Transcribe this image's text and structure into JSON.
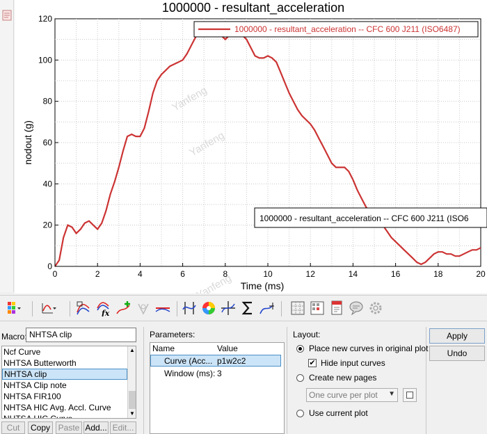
{
  "plot": {
    "title": "1000000 - resultant_acceleration",
    "legend_text": "1000000 - resultant_acceleration -- CFC 600  J211 (ISO6487)",
    "tooltip_text": "1000000 - resultant_acceleration -- CFC 600  J211 (ISO6",
    "watermark": "Yanfeng",
    "curve_color": "#cc3333"
  },
  "chart_data": {
    "type": "line",
    "title": "1000000 - resultant_acceleration",
    "xlabel": "Time (ms)",
    "ylabel": "nodout (g)",
    "xlim": [
      0,
      20
    ],
    "ylim": [
      0,
      120
    ],
    "x_ticks": [
      "0",
      "2",
      "4",
      "6",
      "8",
      "10",
      "12",
      "14",
      "16",
      "18",
      "20"
    ],
    "y_ticks": [
      "0",
      "20",
      "40",
      "60",
      "80",
      "100",
      "120"
    ],
    "grid": true,
    "legend": "top-right",
    "series": [
      {
        "name": "1000000 - resultant_acceleration -- CFC 600  J211 (ISO6487)",
        "x": [
          0,
          0.2,
          0.4,
          0.6,
          0.8,
          1.0,
          1.2,
          1.4,
          1.6,
          1.8,
          2.0,
          2.2,
          2.4,
          2.6,
          2.8,
          3.0,
          3.2,
          3.4,
          3.6,
          3.8,
          4.0,
          4.2,
          4.4,
          4.6,
          4.8,
          5.0,
          5.2,
          5.4,
          5.6,
          5.8,
          6.0,
          6.2,
          6.4,
          6.6,
          6.8,
          7.0,
          7.4,
          7.8,
          8.0,
          8.2,
          8.6,
          9.0,
          9.2,
          9.4,
          9.6,
          9.8,
          10.0,
          10.2,
          10.4,
          10.6,
          10.8,
          11.0,
          11.2,
          11.4,
          11.6,
          11.8,
          12.0,
          12.2,
          12.4,
          12.6,
          12.8,
          13.0,
          13.2,
          13.4,
          13.6,
          13.8,
          14.0,
          14.2,
          14.4,
          14.6,
          14.8,
          15.0,
          15.2,
          15.4,
          15.6,
          15.8,
          16.0,
          16.2,
          16.4,
          16.6,
          16.8,
          17.0,
          17.2,
          17.4,
          17.6,
          17.8,
          18.0,
          18.2,
          18.4,
          18.6,
          18.8,
          19.0,
          19.2,
          19.4,
          19.6,
          19.8,
          20.0
        ],
        "y": [
          0,
          3,
          14,
          20,
          19,
          16,
          18,
          21,
          22,
          20,
          18,
          21,
          27,
          35,
          41,
          48,
          56,
          63,
          64,
          63,
          63,
          67,
          75,
          84,
          90,
          93,
          95,
          97,
          98,
          99,
          100,
          103,
          107,
          111,
          114,
          116,
          117,
          112,
          110,
          112,
          114,
          110,
          106,
          102,
          101,
          101,
          102,
          101,
          99,
          94,
          89,
          84,
          80,
          76,
          73,
          71,
          69,
          66,
          62,
          58,
          54,
          50,
          48,
          48,
          48,
          46,
          42,
          37,
          33,
          29,
          26,
          24,
          22,
          20,
          17,
          14,
          12,
          10,
          8,
          6,
          4,
          2,
          1,
          2,
          4,
          6,
          7,
          7,
          6,
          6,
          5,
          5,
          6,
          7,
          8,
          8,
          9
        ]
      }
    ]
  },
  "toolbar": {
    "icons": [
      "layout-colors-icon",
      "curve-dropdown-icon",
      "define-curve-icon",
      "curve-math-fx-icon",
      "add-point-icon",
      "vector-icon",
      "horizontal-line-icon",
      "flip-icon",
      "color-wheel-icon",
      "crosshair-icon",
      "sigma-icon",
      "trace-icon",
      "grid-icon",
      "table-icon",
      "report-icon",
      "notes-icon",
      "settings-gear-icon"
    ]
  },
  "macro": {
    "label": "Macro:",
    "value": "NHTSA clip",
    "items": [
      "Ncf Curve",
      "NHTSA Butterworth",
      "NHTSA clip",
      "NHTSA Clip note",
      "NHTSA FIR100",
      "NHTSA HIC Avg. Accl. Curve",
      "NHTSA HIC Curve"
    ],
    "selected_index": 2,
    "buttons": [
      "Cut",
      "Copy",
      "Paste",
      "Add...",
      "Edit..."
    ]
  },
  "parameters": {
    "label": "Parameters:",
    "col_name": "Name",
    "col_value": "Value",
    "rows": [
      {
        "name": "Curve (Acc...",
        "value": "p1w2c2"
      },
      {
        "name": "Window (ms):",
        "value": "3"
      }
    ]
  },
  "layout": {
    "label": "Layout:",
    "opt_original": "Place new curves in original plot",
    "hide_input": "Hide input curves",
    "opt_new_pages": "Create new pages",
    "pages_select": "One curve per plot",
    "opt_current": "Use current plot"
  },
  "actions": {
    "apply": "Apply",
    "undo": "Undo"
  }
}
